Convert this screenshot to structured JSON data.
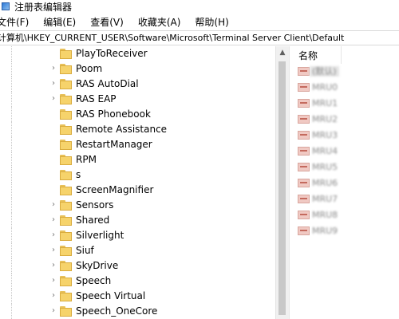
{
  "window": {
    "title": "注册表编辑器"
  },
  "menu": [
    {
      "label": "文件(F)"
    },
    {
      "label": "编辑(E)"
    },
    {
      "label": "查看(V)"
    },
    {
      "label": "收藏夹(A)"
    },
    {
      "label": "帮助(H)"
    }
  ],
  "address": {
    "path": "计算机\\HKEY_CURRENT_USER\\Software\\Microsoft\\Terminal Server Client\\Default"
  },
  "tree": {
    "items": [
      {
        "label": "PlayToReceiver",
        "has_children": false
      },
      {
        "label": "Poom",
        "has_children": true
      },
      {
        "label": "RAS AutoDial",
        "has_children": true
      },
      {
        "label": "RAS EAP",
        "has_children": true
      },
      {
        "label": "RAS Phonebook",
        "has_children": false
      },
      {
        "label": "Remote Assistance",
        "has_children": false
      },
      {
        "label": "RestartManager",
        "has_children": false
      },
      {
        "label": "RPM",
        "has_children": false
      },
      {
        "label": "s",
        "has_children": false
      },
      {
        "label": "ScreenMagnifier",
        "has_children": false
      },
      {
        "label": "Sensors",
        "has_children": true
      },
      {
        "label": "Shared",
        "has_children": true
      },
      {
        "label": "Silverlight",
        "has_children": true
      },
      {
        "label": "Siuf",
        "has_children": true
      },
      {
        "label": "SkyDrive",
        "has_children": true
      },
      {
        "label": "Speech",
        "has_children": true
      },
      {
        "label": "Speech Virtual",
        "has_children": true
      },
      {
        "label": "Speech_OneCore",
        "has_children": true
      }
    ]
  },
  "values_pane": {
    "column_name": "名称",
    "items": [
      {
        "name": "(默认)",
        "selected": true
      },
      {
        "name": "MRU0",
        "selected": false
      },
      {
        "name": "MRU1",
        "selected": false
      },
      {
        "name": "MRU2",
        "selected": false
      },
      {
        "name": "MRU3",
        "selected": false
      },
      {
        "name": "MRU4",
        "selected": false
      },
      {
        "name": "MRU5",
        "selected": false
      },
      {
        "name": "MRU6",
        "selected": false
      },
      {
        "name": "MRU7",
        "selected": false
      },
      {
        "name": "MRU8",
        "selected": false
      },
      {
        "name": "MRU9",
        "selected": false
      }
    ]
  },
  "icons": {
    "folder": "folder-icon",
    "string_value": "registry-string-value-icon",
    "expand": "chevron-right-icon",
    "scroll_up": "chevron-up-icon"
  },
  "colors": {
    "folder_fill": "#f6d36b",
    "folder_border": "#d9ac3e",
    "scrollbar_track": "#f0f0f0",
    "scrollbar_thumb": "#c8c8c8"
  }
}
